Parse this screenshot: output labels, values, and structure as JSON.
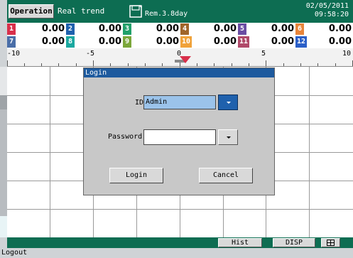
{
  "header": {
    "operation_label": "Operation",
    "mode_label": "Real trend",
    "storage_icon": "floppy-disk-icon",
    "remaining_label": "Rem.3.8day",
    "date": "02/05/2011",
    "time": "09:58:20"
  },
  "channels": [
    {
      "num": "1",
      "value": "0.00",
      "color": "#d9304b"
    },
    {
      "num": "2",
      "value": "0.00",
      "color": "#1f61ad"
    },
    {
      "num": "3",
      "value": "0.00",
      "color": "#20a06a"
    },
    {
      "num": "4",
      "value": "0.00",
      "color": "#a0652a"
    },
    {
      "num": "5",
      "value": "0.00",
      "color": "#6a4da3"
    },
    {
      "num": "6",
      "value": "0.00",
      "color": "#e8853a"
    },
    {
      "num": "7",
      "value": "0.00",
      "color": "#4a6ea8"
    },
    {
      "num": "8",
      "value": "0.00",
      "color": "#1aa8a0"
    },
    {
      "num": "9",
      "value": "0.00",
      "color": "#7ba63a"
    },
    {
      "num": "10",
      "value": "0.00",
      "color": "#f0a23a"
    },
    {
      "num": "11",
      "value": "0.00",
      "color": "#b04a6a"
    },
    {
      "num": "12",
      "value": "0.00",
      "color": "#2a5fc8"
    }
  ],
  "scale": {
    "labels": [
      "-10",
      "-5",
      "0",
      "5",
      "10"
    ]
  },
  "dialog": {
    "title": "Login",
    "id_label": "ID",
    "id_value": "Admin",
    "password_label": "Password",
    "password_value": "",
    "login_button": "Login",
    "cancel_button": "Cancel"
  },
  "bottom": {
    "hist_label": "Hist",
    "disp_label": "DISP",
    "grid_icon": "grid-icon"
  },
  "status": {
    "text": "Logout"
  },
  "colors": {
    "header_green": "#0d6d52",
    "dialog_title_blue": "#1d5a9e",
    "id_field_blue": "#9bc3ea",
    "marker_red": "#d9304b"
  }
}
